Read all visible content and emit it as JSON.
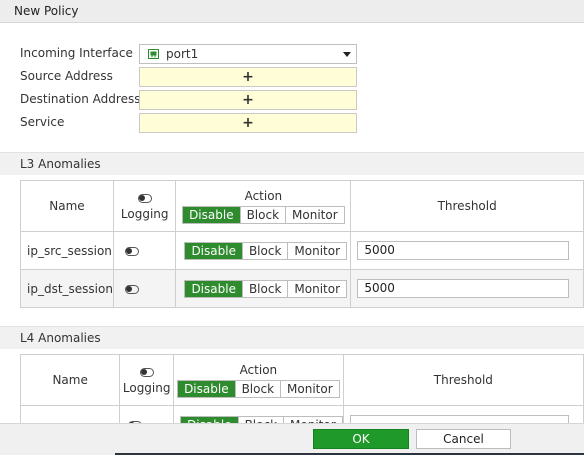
{
  "window": {
    "title": "New Policy"
  },
  "policy": {
    "incoming_interface_label": "Incoming Interface",
    "incoming_interface_value": "port1",
    "source_address_label": "Source Address",
    "destination_address_label": "Destination Address",
    "service_label": "Service",
    "add_symbol": "+"
  },
  "l3": {
    "title": "L3 Anomalies",
    "headers": {
      "name": "Name",
      "logging": "Logging",
      "action": "Action",
      "threshold": "Threshold"
    },
    "action_options": [
      "Disable",
      "Block",
      "Monitor"
    ],
    "rows": [
      {
        "name": "ip_src_session",
        "action": "Disable",
        "threshold": "5000"
      },
      {
        "name": "ip_dst_session",
        "action": "Disable",
        "threshold": "5000"
      }
    ]
  },
  "l4": {
    "title": "L4 Anomalies",
    "headers": {
      "name": "Name",
      "logging": "Logging",
      "action": "Action",
      "threshold": "Threshold"
    },
    "action_options": [
      "Disable",
      "Block",
      "Monitor"
    ]
  },
  "footer": {
    "ok_label": "OK",
    "cancel_label": "Cancel"
  },
  "colors": {
    "accent_green": "#2e8b2e",
    "ok_green": "#1f9a2a",
    "address_field_bg": "#fffed6"
  },
  "icons": {
    "interface": "port-icon",
    "logging": "toggle-icon"
  }
}
